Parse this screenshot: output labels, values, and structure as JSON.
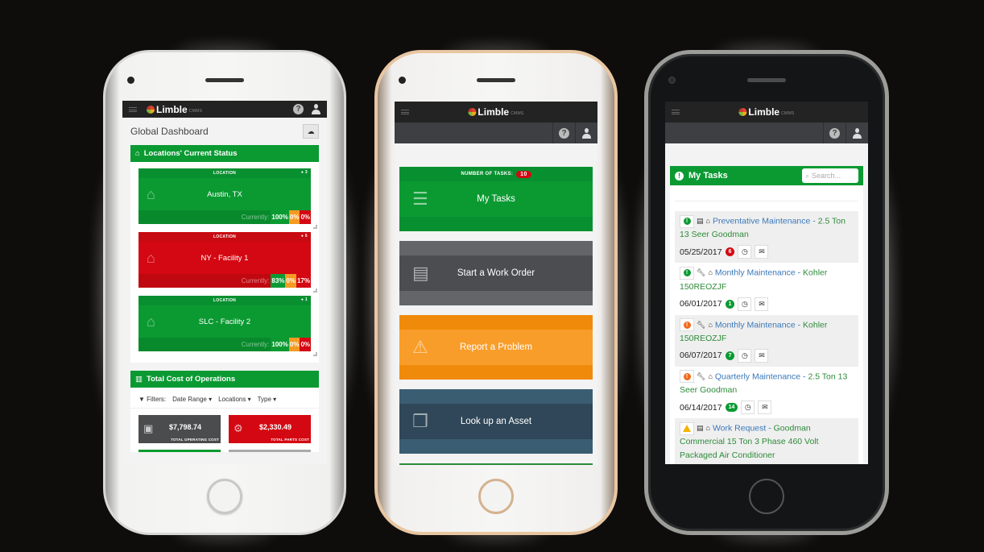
{
  "brand": {
    "name": "Limble",
    "suffix": "CMMS",
    "accent": "#0b9a32",
    "danger": "#d40812",
    "warning": "#f99d2a"
  },
  "phone1": {
    "title": "Global Dashboard",
    "status_panel": {
      "title": "Locations' Current Status",
      "locations": [
        {
          "header": "LOCATION",
          "count": "3",
          "name": "Austin, TX",
          "status": "green",
          "currently_label": "Currently:",
          "pct_green": "100%",
          "pct_orange": "0%",
          "pct_red": "0%"
        },
        {
          "header": "LOCATION",
          "count": "6",
          "name": "NY - Facility 1",
          "status": "red",
          "currently_label": "Currently:",
          "pct_green": "83%",
          "pct_orange": "0%",
          "pct_red": "17%"
        },
        {
          "header": "LOCATION",
          "count": "1",
          "name": "SLC - Facility 2",
          "status": "green",
          "currently_label": "Currently:",
          "pct_green": "100%",
          "pct_orange": "0%",
          "pct_red": "0%"
        }
      ]
    },
    "cost_panel": {
      "title": "Total Cost of Operations",
      "filters_label": "Filters:",
      "filters": [
        "Date Range",
        "Locations",
        "Type"
      ],
      "cards": [
        {
          "value": "$7,798.74",
          "label": "TOTAL OPERATING COST"
        },
        {
          "value": "$2,330.49",
          "label": "TOTAL PARTS COST"
        }
      ]
    }
  },
  "phone2": {
    "tasks_header": "NUMBER OF TASKS:",
    "tasks_count": "10",
    "tiles": [
      {
        "label": "My Tasks"
      },
      {
        "label": "Start a Work Order"
      },
      {
        "label": "Report a Problem"
      },
      {
        "label": "Look up an Asset"
      }
    ]
  },
  "phone3": {
    "title": "My Tasks",
    "search_placeholder": "Search...",
    "tasks": [
      {
        "priority": "green",
        "type": "work-order",
        "title": "Preventative Maintenance",
        "asset": "2.5 Ton 13 Seer Goodman",
        "date": "05/25/2017",
        "count": "6",
        "count_color": "red"
      },
      {
        "priority": "green",
        "type": "wrench",
        "title": "Monthly Maintenance",
        "asset": "Kohler 150REOZJF",
        "date": "06/01/2017",
        "count": "1",
        "count_color": "green"
      },
      {
        "priority": "orange",
        "type": "wrench",
        "title": "Monthly Maintenance",
        "asset": "Kohler 150REOZJF",
        "date": "06/07/2017",
        "count": "7",
        "count_color": "green"
      },
      {
        "priority": "orange",
        "type": "wrench",
        "title": "Quarterly Maintenance",
        "asset": "2.5 Ton 13 Seer Goodman",
        "date": "06/14/2017",
        "count": "14",
        "count_color": "green"
      },
      {
        "priority": "warning",
        "type": "work-order",
        "title": "Work Request",
        "asset": "Goodman Commercial 15 Ton 3 Phase 460 Volt Packaged Air Conditioner",
        "date": "",
        "count": "",
        "count_color": ""
      }
    ]
  }
}
